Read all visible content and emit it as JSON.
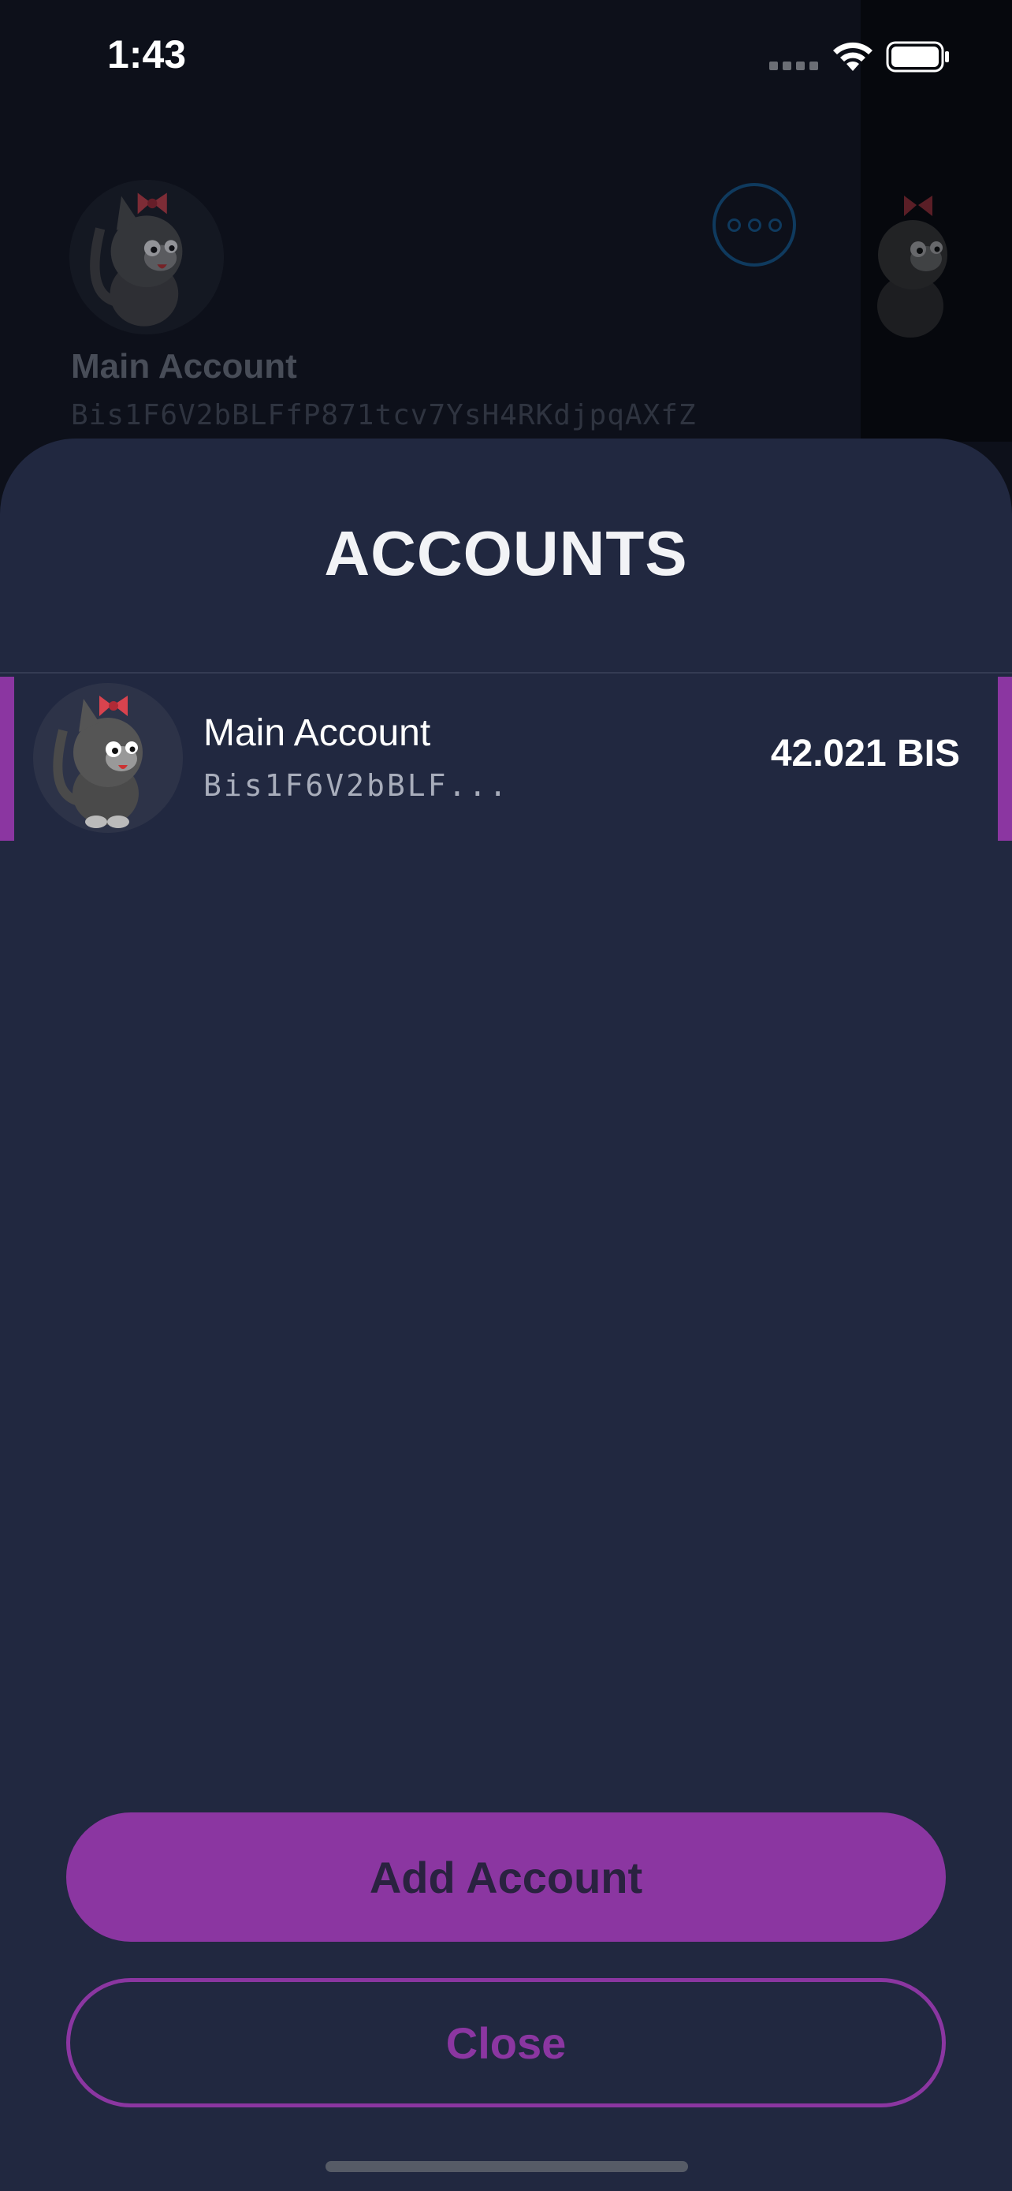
{
  "status_bar": {
    "time": "1:43"
  },
  "background": {
    "account_name": "Main Account",
    "account_address": "Bis1F6V2bBLFfP871tcv7YsH4RKdjpqAXfZ",
    "more_button_icon": "more-horizontal-icon"
  },
  "sheet": {
    "title": "ACCOUNTS",
    "accounts": [
      {
        "name": "Main Account",
        "address": "Bis1F6V2bBLF...",
        "balance": "42.021 BIS",
        "avatar_icon": "cat-avatar-icon",
        "selected": true
      }
    ],
    "add_button_label": "Add Account",
    "close_button_label": "Close"
  },
  "colors": {
    "sheet_background": "#212840",
    "accent": "#8b36a1",
    "screen_background": "#0d101a"
  }
}
